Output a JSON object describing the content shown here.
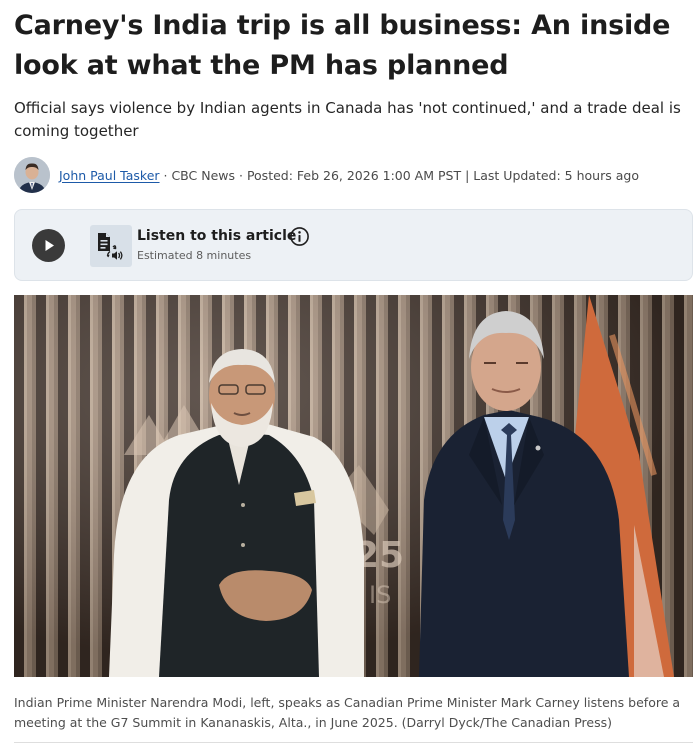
{
  "article": {
    "headline": "Carney's India trip is all business: An inside look at what the PM has planned",
    "dek": "Official says violence by Indian agents in Canada has 'not continued,' and a trade deal is coming together",
    "byline": {
      "author": "John Paul Tasker",
      "source": " · CBC News · ",
      "posted": "Posted: Feb 26, 2026 1:00 AM PST",
      "separator": " | ",
      "updated": "Last Updated: 5 hours ago"
    },
    "caption": "Indian Prime Minister Narendra Modi, left, speaks as Canadian Prime Minister Mark Carney listens before a meeting at the G7 Summit in Kananaskis, Alta., in June 2025. (Darryl Dyck/The Canadian Press)"
  },
  "listen": {
    "title": "Listen to this article",
    "subtitle": "Estimated 8 minutes",
    "icons": [
      "play-icon",
      "document-audio-icon",
      "info-icon"
    ]
  },
  "photo": {
    "backdrop_lettering": [
      "25",
      "IS"
    ]
  },
  "colors": {
    "link": "#1d5aa8",
    "listen_bg": "#edf1f5",
    "play_button": "#3a3a3a"
  }
}
